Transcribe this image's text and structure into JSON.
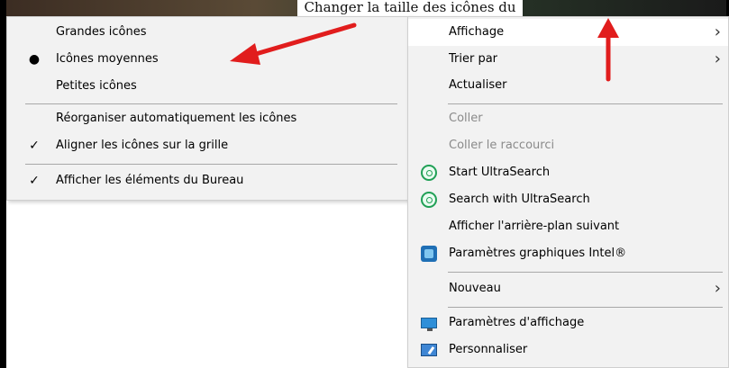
{
  "page_heading": "Changer la taille des icônes du Bureau",
  "submenu": {
    "items": [
      {
        "label": "Grandes icônes",
        "mark": ""
      },
      {
        "label": "Icônes moyennes",
        "mark": "●"
      },
      {
        "label": "Petites icônes",
        "mark": ""
      },
      {
        "label": "Réorganiser automatiquement les icônes",
        "mark": ""
      },
      {
        "label": "Aligner les icônes sur la grille",
        "mark": "✓"
      },
      {
        "label": "Afficher les éléments du Bureau",
        "mark": "✓"
      }
    ]
  },
  "menu": {
    "items": [
      {
        "label": "Affichage",
        "submenu_chevron": "›",
        "highlighted": true
      },
      {
        "label": "Trier par",
        "submenu_chevron": "›"
      },
      {
        "label": "Actualiser"
      },
      {
        "label": "Coller",
        "disabled": true
      },
      {
        "label": "Coller le raccourci",
        "disabled": true
      },
      {
        "label": "Start UltraSearch",
        "icon": "search-icon"
      },
      {
        "label": "Search with UltraSearch",
        "icon": "search-icon"
      },
      {
        "label": "Afficher l'arrière-plan suivant"
      },
      {
        "label": "Paramètres graphiques Intel®",
        "icon": "intel-icon"
      },
      {
        "label": "Nouveau",
        "submenu_chevron": "›"
      },
      {
        "label": "Paramètres d'affichage",
        "icon": "display-icon"
      },
      {
        "label": "Personnaliser",
        "icon": "personalize-icon"
      }
    ]
  },
  "colors": {
    "menu_background": "#f2f2f2",
    "highlight": "#ffffff",
    "disabled_text": "#8a8a8a",
    "annotation_arrow": "#e11d1d",
    "ultrasearch_green": "#21a056"
  }
}
